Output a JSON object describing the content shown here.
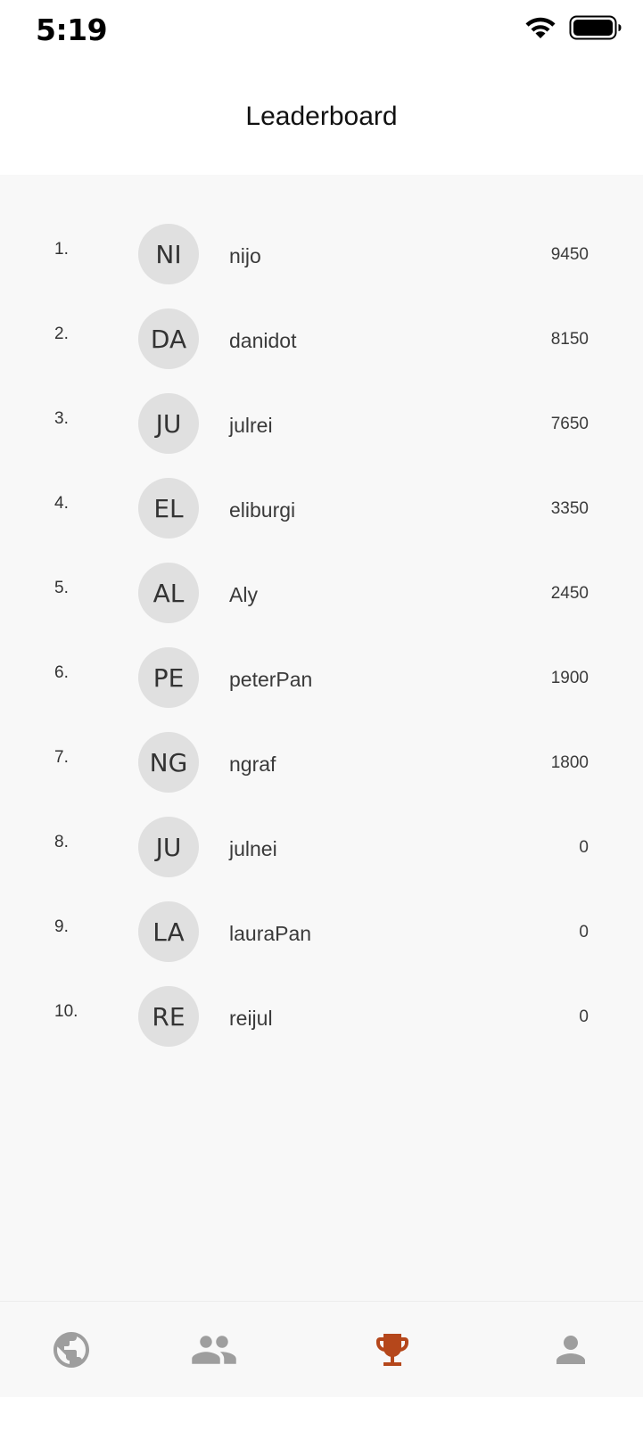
{
  "status_bar": {
    "time": "5:19",
    "icons": [
      "wifi-icon",
      "battery-icon"
    ]
  },
  "header": {
    "title": "Leaderboard"
  },
  "leaderboard": {
    "entries": [
      {
        "rank": "1.",
        "initials": "NI",
        "username": "nijo",
        "score": "9450"
      },
      {
        "rank": "2.",
        "initials": "DA",
        "username": "danidot",
        "score": "8150"
      },
      {
        "rank": "3.",
        "initials": "JU",
        "username": "julrei",
        "score": "7650"
      },
      {
        "rank": "4.",
        "initials": "EL",
        "username": "eliburgi",
        "score": "3350"
      },
      {
        "rank": "5.",
        "initials": "AL",
        "username": "Aly",
        "score": "2450"
      },
      {
        "rank": "6.",
        "initials": "PE",
        "username": "peterPan",
        "score": "1900"
      },
      {
        "rank": "7.",
        "initials": "NG",
        "username": "ngraf",
        "score": "1800"
      },
      {
        "rank": "8.",
        "initials": "JU",
        "username": "julnei",
        "score": "0"
      },
      {
        "rank": "9.",
        "initials": "LA",
        "username": "lauraPan",
        "score": "0"
      },
      {
        "rank": "10.",
        "initials": "RE",
        "username": "reijul",
        "score": "0"
      }
    ]
  },
  "bottom_nav": {
    "items": [
      {
        "icon": "globe-icon",
        "active": false
      },
      {
        "icon": "people-icon",
        "active": false
      },
      {
        "icon": "trophy-icon",
        "active": true
      },
      {
        "icon": "person-icon",
        "active": false
      }
    ]
  },
  "colors": {
    "accent": "#b5471b",
    "inactive_icon": "#9e9e9e",
    "avatar_bg": "#e0e0e0",
    "list_bg": "#f8f8f8"
  }
}
